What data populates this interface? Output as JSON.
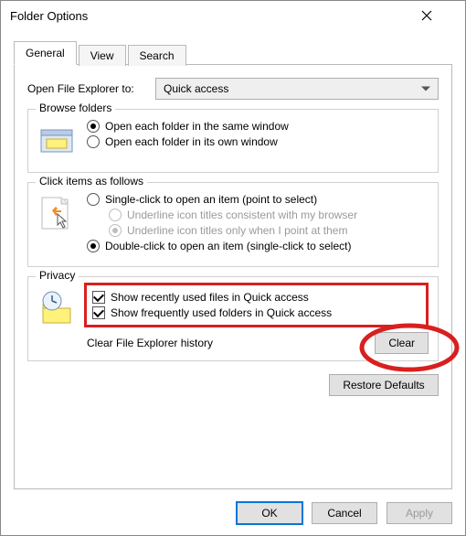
{
  "window": {
    "title": "Folder Options"
  },
  "tabs": {
    "general": "General",
    "view": "View",
    "search": "Search"
  },
  "openRow": {
    "label": "Open File Explorer to:",
    "value": "Quick access"
  },
  "browse": {
    "legend": "Browse folders",
    "same": "Open each folder in the same window",
    "own": "Open each folder in its own window"
  },
  "click": {
    "legend": "Click items as follows",
    "single": "Single-click to open an item (point to select)",
    "sub1": "Underline icon titles consistent with my browser",
    "sub2": "Underline icon titles only when I point at them",
    "double": "Double-click to open an item (single-click to select)"
  },
  "privacy": {
    "legend": "Privacy",
    "recent": "Show recently used files in Quick access",
    "frequent": "Show frequently used folders in Quick access",
    "clearLabel": "Clear File Explorer history",
    "clearButton": "Clear"
  },
  "restore": "Restore Defaults",
  "buttons": {
    "ok": "OK",
    "cancel": "Cancel",
    "apply": "Apply"
  }
}
